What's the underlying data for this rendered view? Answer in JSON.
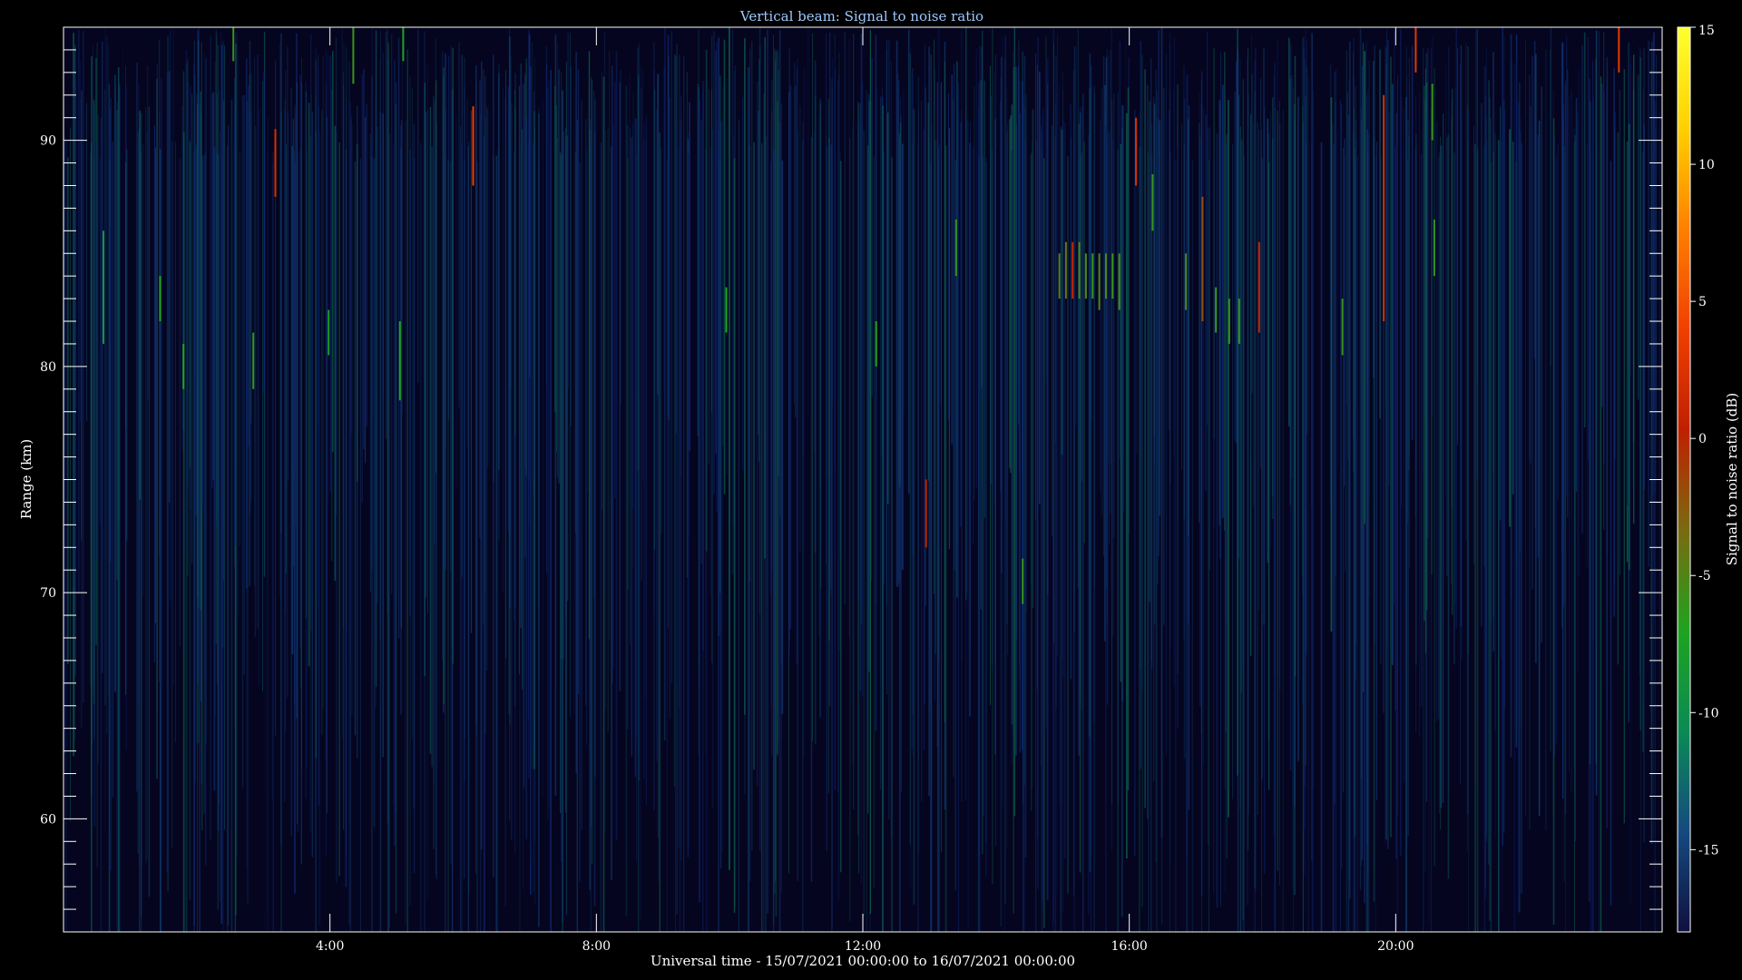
{
  "chart_data": {
    "type": "heatmap",
    "title": "Vertical beam: Signal to noise ratio",
    "xlabel": "Universal time - 15/07/2021 00:00:00 to 16/07/2021 00:00:00",
    "ylabel": "Range (km)",
    "xlim_hours": [
      0,
      24
    ],
    "ylim": [
      55,
      95
    ],
    "x_ticks": [
      {
        "hour": 4,
        "label": "4:00"
      },
      {
        "hour": 8,
        "label": "8:00"
      },
      {
        "hour": 12,
        "label": "12:00"
      },
      {
        "hour": 16,
        "label": "16:00"
      },
      {
        "hour": 20,
        "label": "20:00"
      }
    ],
    "y_ticks": [
      60,
      70,
      80,
      90
    ],
    "y_ticks_minor_step": 1,
    "grid": false,
    "colorbar": {
      "label": "Signal to noise ratio (dB)",
      "range": [
        -18,
        15
      ],
      "ticks": [
        -15,
        -10,
        -5,
        0,
        5,
        10,
        15
      ],
      "colormap": [
        "#101040",
        "#154a80",
        "#0b8a55",
        "#1fa31f",
        "#7a6a10",
        "#c02000",
        "#f04000",
        "#ff8000",
        "#ffd000",
        "#ffff30"
      ]
    },
    "echoes": [
      {
        "hour": 0.6,
        "range_min": 81,
        "range_max": 86,
        "snr": -9
      },
      {
        "hour": 1.45,
        "range_min": 82,
        "range_max": 84,
        "snr": -7
      },
      {
        "hour": 1.8,
        "range_min": 79,
        "range_max": 81,
        "snr": -7
      },
      {
        "hour": 2.55,
        "range_min": 93.5,
        "range_max": 95,
        "snr": -6
      },
      {
        "hour": 2.85,
        "range_min": 79,
        "range_max": 81.5,
        "snr": -6
      },
      {
        "hour": 3.18,
        "range_min": 87.5,
        "range_max": 90.5,
        "snr": 2
      },
      {
        "hour": 3.98,
        "range_min": 80.5,
        "range_max": 82.5,
        "snr": -8
      },
      {
        "hour": 4.35,
        "range_min": 92.5,
        "range_max": 95,
        "snr": -6
      },
      {
        "hour": 5.05,
        "range_min": 78.5,
        "range_max": 82,
        "snr": -7
      },
      {
        "hour": 5.1,
        "range_min": 93.5,
        "range_max": 95,
        "snr": -7
      },
      {
        "hour": 6.15,
        "range_min": 88,
        "range_max": 91.5,
        "snr": 4
      },
      {
        "hour": 9.95,
        "range_min": 81.5,
        "range_max": 83.5,
        "snr": -7
      },
      {
        "hour": 12.2,
        "range_min": 80,
        "range_max": 82,
        "snr": -7
      },
      {
        "hour": 12.95,
        "range_min": 72,
        "range_max": 75,
        "snr": 0
      },
      {
        "hour": 13.4,
        "range_min": 84,
        "range_max": 86.5,
        "snr": -6
      },
      {
        "hour": 14.4,
        "range_min": 69.5,
        "range_max": 71.5,
        "snr": -6
      },
      {
        "hour": 14.95,
        "range_min": 83,
        "range_max": 85,
        "snr": -5
      },
      {
        "hour": 15.05,
        "range_min": 83,
        "range_max": 85.5,
        "snr": -4
      },
      {
        "hour": 15.15,
        "range_min": 83,
        "range_max": 85.5,
        "snr": 1
      },
      {
        "hour": 15.25,
        "range_min": 83,
        "range_max": 85.5,
        "snr": -5
      },
      {
        "hour": 15.35,
        "range_min": 83,
        "range_max": 85,
        "snr": -5
      },
      {
        "hour": 15.45,
        "range_min": 83,
        "range_max": 85,
        "snr": -6
      },
      {
        "hour": 15.55,
        "range_min": 82.5,
        "range_max": 85,
        "snr": -5
      },
      {
        "hour": 15.65,
        "range_min": 83,
        "range_max": 85,
        "snr": -5
      },
      {
        "hour": 15.75,
        "range_min": 83,
        "range_max": 85,
        "snr": -6
      },
      {
        "hour": 15.85,
        "range_min": 82.5,
        "range_max": 85,
        "snr": -5
      },
      {
        "hour": 16.1,
        "range_min": 88,
        "range_max": 91,
        "snr": 2
      },
      {
        "hour": 16.35,
        "range_min": 86,
        "range_max": 88.5,
        "snr": -6
      },
      {
        "hour": 16.85,
        "range_min": 82.5,
        "range_max": 85,
        "snr": -5
      },
      {
        "hour": 17.1,
        "range_min": 82,
        "range_max": 87.5,
        "snr": -2
      },
      {
        "hour": 17.3,
        "range_min": 81.5,
        "range_max": 83.5,
        "snr": -6
      },
      {
        "hour": 17.5,
        "range_min": 81,
        "range_max": 83,
        "snr": -6
      },
      {
        "hour": 17.65,
        "range_min": 81,
        "range_max": 83,
        "snr": -6
      },
      {
        "hour": 17.95,
        "range_min": 81.5,
        "range_max": 85.5,
        "snr": 1
      },
      {
        "hour": 19.2,
        "range_min": 80.5,
        "range_max": 83,
        "snr": -6
      },
      {
        "hour": 19.82,
        "range_min": 82,
        "range_max": 92,
        "snr": 2
      },
      {
        "hour": 20.3,
        "range_min": 93,
        "range_max": 95,
        "snr": 3
      },
      {
        "hour": 20.55,
        "range_min": 90,
        "range_max": 92.5,
        "snr": -6
      },
      {
        "hour": 20.58,
        "range_min": 84,
        "range_max": 86.5,
        "snr": -6
      },
      {
        "hour": 23.35,
        "range_min": 93,
        "range_max": 95,
        "snr": 3
      }
    ]
  }
}
